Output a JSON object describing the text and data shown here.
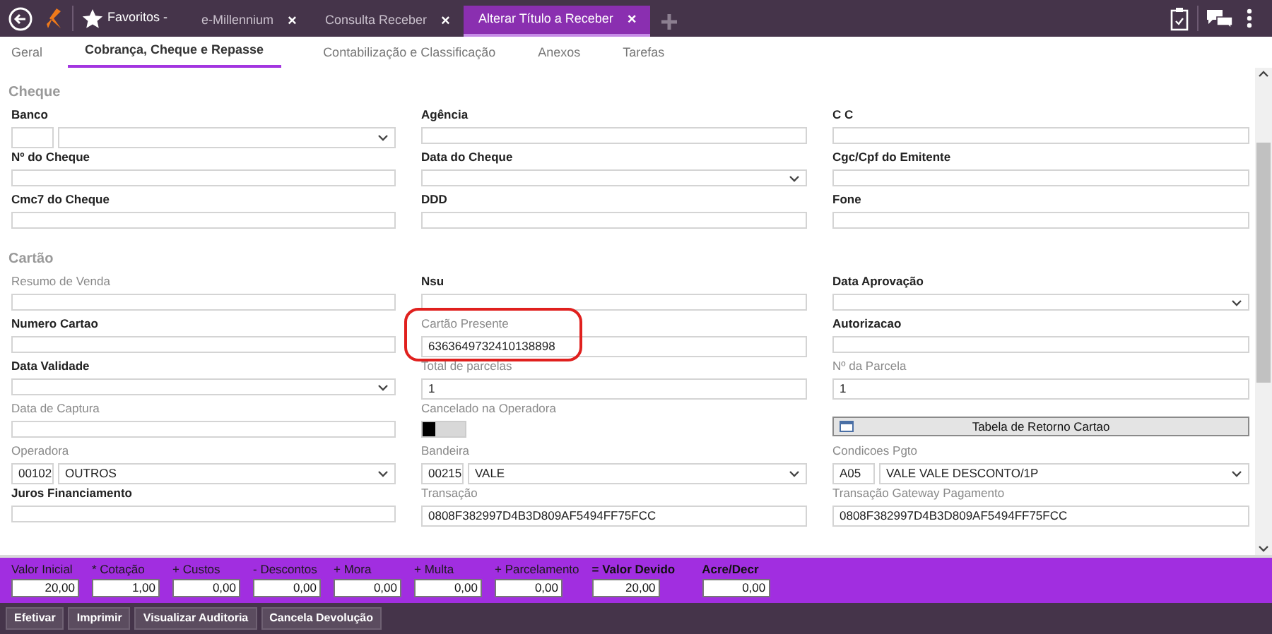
{
  "topbar": {
    "favorites": "Favoritos -",
    "tabs": [
      {
        "label": "e-Millennium",
        "close": "×",
        "selected": false
      },
      {
        "label": "Consulta Receber",
        "close": "×",
        "selected": false
      },
      {
        "label": "Alterar Título a Receber",
        "close": "×",
        "selected": true
      }
    ]
  },
  "subtabs": [
    {
      "label": "Geral",
      "selected": false
    },
    {
      "label": "Cobrança, Cheque e Repasse",
      "selected": true
    },
    {
      "label": "Contabilização e Classificação",
      "selected": false
    },
    {
      "label": "Anexos",
      "selected": false
    },
    {
      "label": "Tarefas",
      "selected": false
    }
  ],
  "sections": [
    {
      "title": "Cheque",
      "fields": [
        {
          "label": "Banco",
          "kind": "code-select",
          "readonly": false
        },
        {
          "label": "Agência",
          "kind": "text",
          "readonly": false
        },
        {
          "label": "C C",
          "kind": "text",
          "readonly": false
        },
        {
          "label": "Nº do Cheque",
          "kind": "text",
          "readonly": false
        },
        {
          "label": "Data do Cheque",
          "kind": "select",
          "readonly": false
        },
        {
          "label": "Cgc/Cpf do Emitente",
          "kind": "text",
          "readonly": false
        },
        {
          "label": "Cmc7 do Cheque",
          "kind": "text",
          "readonly": false
        },
        {
          "label": "DDD",
          "kind": "text",
          "readonly": false
        },
        {
          "label": "Fone",
          "kind": "text",
          "readonly": false
        }
      ]
    },
    {
      "title": "Cartão",
      "fields": [
        {
          "label": "Resumo de Venda",
          "kind": "text",
          "readonly": true
        },
        {
          "label": "Nsu",
          "kind": "text",
          "readonly": false
        },
        {
          "label": "Data Aprovação",
          "kind": "select",
          "readonly": false
        },
        {
          "label": "Numero Cartao",
          "kind": "text",
          "readonly": false
        },
        {
          "label": "Cartão Presente",
          "kind": "text",
          "readonly": true,
          "value": "6363649732410138898",
          "highlighted": true
        },
        {
          "label": "Autorizacao",
          "kind": "text",
          "readonly": false
        },
        {
          "label": "Data Validade",
          "kind": "select",
          "readonly": false
        },
        {
          "label": "Total de parcelas",
          "kind": "text",
          "readonly": true,
          "value": "1"
        },
        {
          "label": "Nº da Parcela",
          "kind": "text",
          "readonly": true,
          "value": "1"
        },
        {
          "label": "Data de Captura",
          "kind": "text",
          "readonly": true
        },
        {
          "label": "Cancelado na Operadora",
          "kind": "toggle",
          "readonly": true,
          "on": false
        },
        {
          "label": "Tabela de Retorno Cartao",
          "kind": "button"
        },
        {
          "label": "Operadora",
          "kind": "code-select",
          "readonly": true,
          "code": "00102",
          "value": "OUTROS"
        },
        {
          "label": "Bandeira",
          "kind": "code-select",
          "readonly": true,
          "code": "00215",
          "value": "VALE"
        },
        {
          "label": "Condicoes Pgto",
          "kind": "code-select",
          "readonly": true,
          "code": "A05",
          "value": "VALE VALE DESCONTO/1P"
        },
        {
          "label": "Juros Financiamento",
          "kind": "text",
          "readonly": false
        },
        {
          "label": "Transação",
          "kind": "text",
          "readonly": true,
          "value": "0808F382997D4B3D809AF5494FF75FCC"
        },
        {
          "label": "Transação Gateway Pagamento",
          "kind": "text",
          "readonly": true,
          "value": "0808F382997D4B3D809AF5494FF75FCC"
        }
      ]
    }
  ],
  "totals": [
    {
      "label": "Valor Inicial",
      "value": "20,00",
      "bold": false
    },
    {
      "label": "* Cotação",
      "value": "1,00",
      "bold": false
    },
    {
      "label": "+ Custos",
      "value": "0,00",
      "bold": false
    },
    {
      "label": "- Descontos",
      "value": "0,00",
      "bold": false
    },
    {
      "label": "+ Mora",
      "value": "0,00",
      "bold": false
    },
    {
      "label": "+ Multa",
      "value": "0,00",
      "bold": false
    },
    {
      "label": "+ Parcelamento",
      "value": "0,00",
      "bold": false
    },
    {
      "label": "= Valor Devido",
      "value": "20,00",
      "bold": true
    },
    {
      "label": "Acre/Decr",
      "value": "0,00",
      "bold": true
    }
  ],
  "actions": [
    "Efetivar",
    "Imprimir",
    "Visualizar Auditoria",
    "Cancela Devolução"
  ]
}
